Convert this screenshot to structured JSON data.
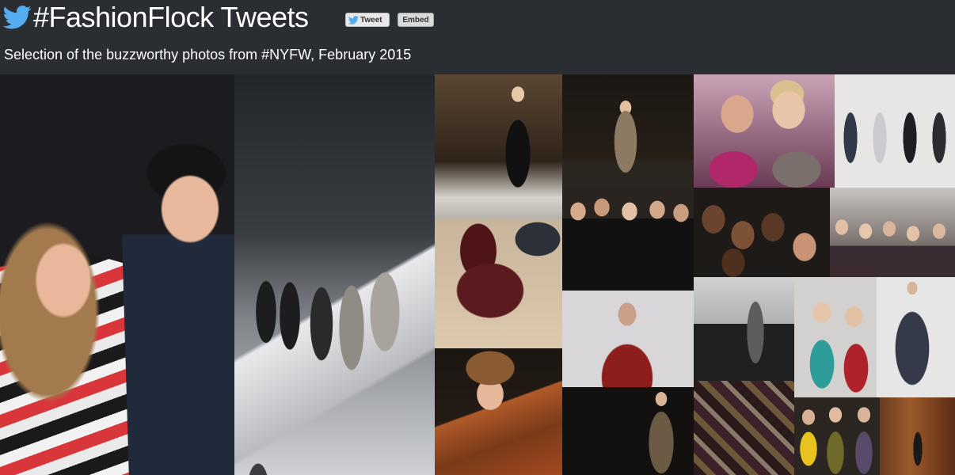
{
  "header": {
    "title": "#FashionFlock Tweets",
    "tweet_label": "Tweet",
    "embed_label": "Embed",
    "subtitle": "Selection of the buzzworthy photos from #NYFW, February 2015"
  },
  "colors": {
    "background": "#2a2e33",
    "twitter_blue": "#55acee",
    "text": "#ffffff"
  }
}
